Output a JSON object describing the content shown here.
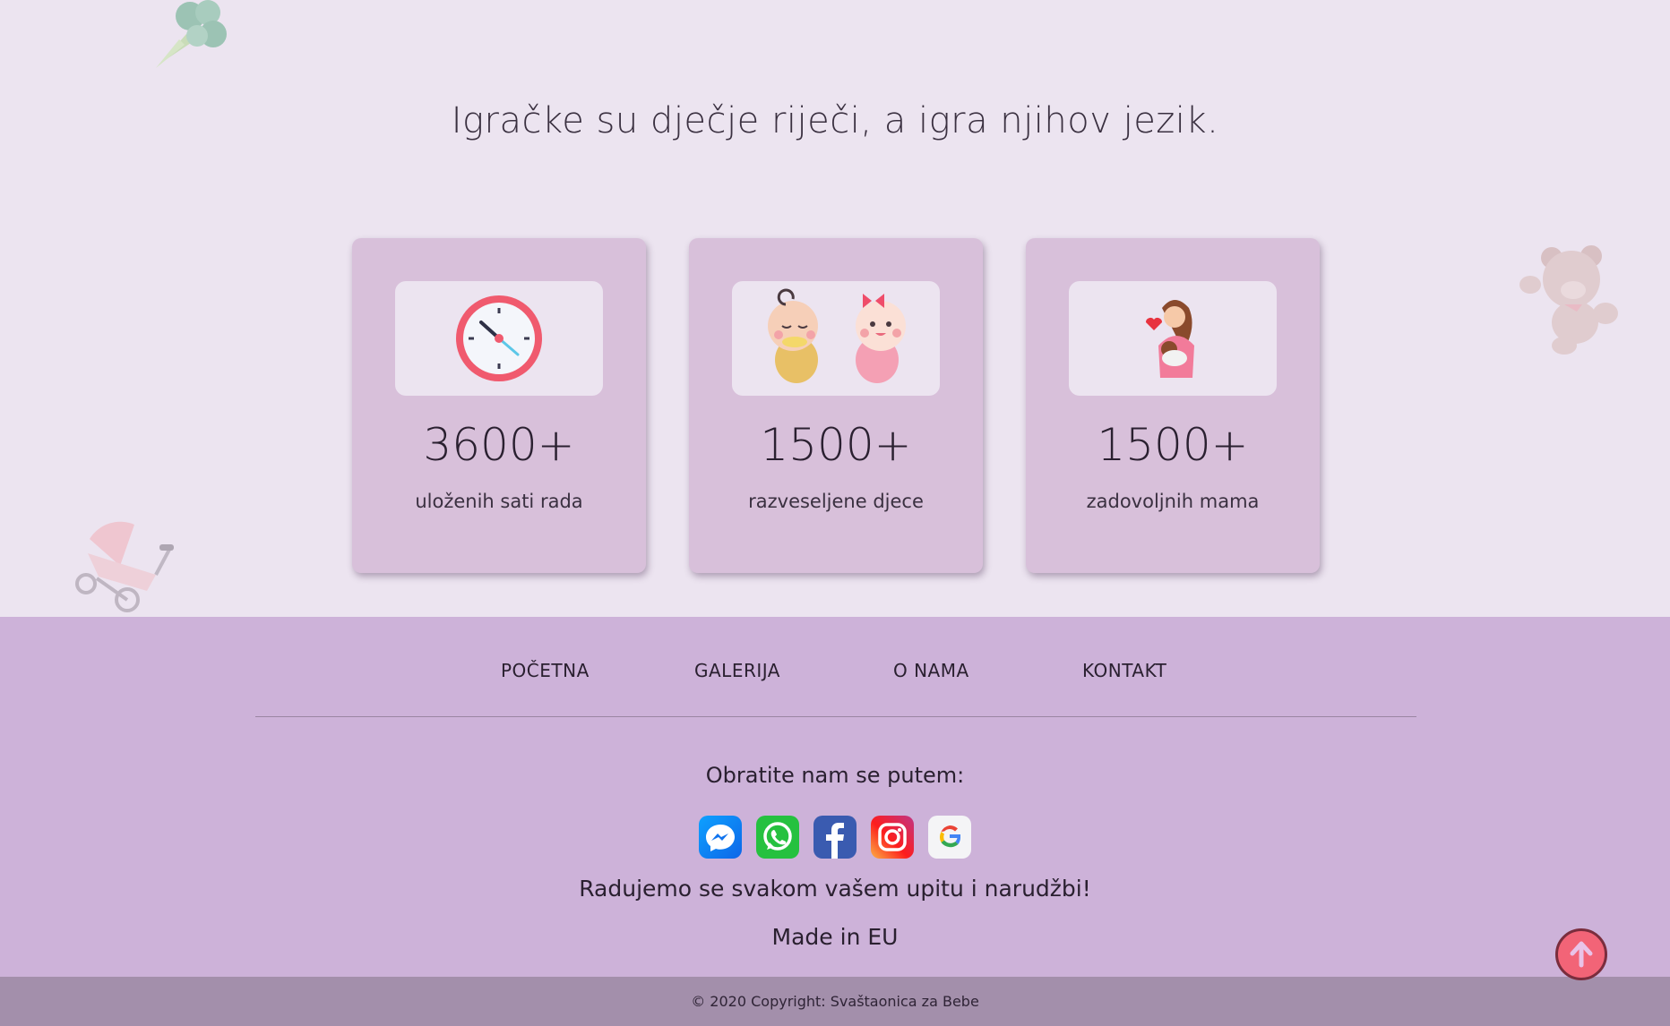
{
  "tagline": "Igračke su dječje riječi, a igra njihov jezik.",
  "stats": [
    {
      "icon": "clock-icon",
      "value": "3600+",
      "label": "uloženih sati rada"
    },
    {
      "icon": "babies-icon",
      "value": "1500+",
      "label": "razveseljene djece"
    },
    {
      "icon": "mother-baby-icon",
      "value": "1500+",
      "label": "zadovoljnih mama"
    }
  ],
  "footer": {
    "nav": [
      "POČETNA",
      "GALERIJA",
      "O NAMA",
      "KONTAKT"
    ],
    "contact_title": "Obratite nam se putem:",
    "socials": [
      "messenger-icon",
      "whatsapp-icon",
      "facebook-icon",
      "instagram-icon",
      "google-icon"
    ],
    "welcome": "Radujemo se svakom vašem upitu i narudžbi!",
    "made_in": "Made in EU",
    "copyright": "© 2020 Copyright: Svaštaonica za Bebe"
  },
  "colors": {
    "background": "#ece4f0",
    "card": "#d8c0da",
    "footer": "#cdb2d9",
    "copyright_bar": "#a38fab",
    "accent": "#f26477"
  },
  "decorations": [
    "broccoli-icon",
    "teddy-bear-icon",
    "stroller-icon"
  ]
}
